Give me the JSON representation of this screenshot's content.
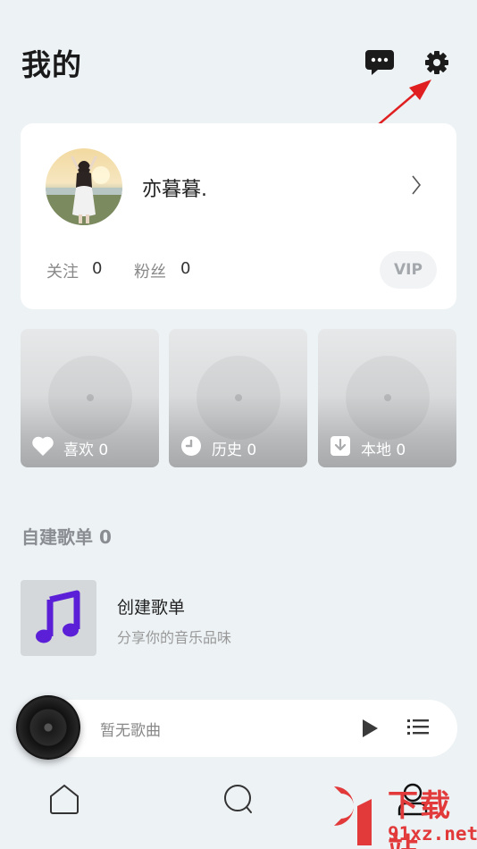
{
  "header": {
    "title": "我的",
    "message_icon": "chat-bubble-icon",
    "settings_icon": "gear-icon"
  },
  "profile": {
    "username": "亦暮暮.",
    "follow_label": "关注",
    "follow_count": "0",
    "fans_label": "粉丝",
    "fans_count": "0",
    "vip_label": "VIP"
  },
  "quick_access": [
    {
      "label": "喜欢 0",
      "icon": "heart-icon"
    },
    {
      "label": "历史 0",
      "icon": "clock-icon"
    },
    {
      "label": "本地 0",
      "icon": "download-icon"
    }
  ],
  "playlists": {
    "section_title": "自建歌单 0",
    "create_title": "创建歌单",
    "create_subtitle": "分享你的音乐品味"
  },
  "player": {
    "now_playing": "暂无歌曲"
  },
  "bottom_nav": [
    {
      "icon": "home-icon"
    },
    {
      "icon": "search-icon"
    },
    {
      "icon": "profile-icon"
    }
  ],
  "watermark": {
    "text": "下载站",
    "url": "91xz.net"
  },
  "colors": {
    "background": "#edf2f5",
    "card": "#ffffff",
    "accent_purple": "#5a1fd6",
    "annotation_red": "#e02020"
  }
}
